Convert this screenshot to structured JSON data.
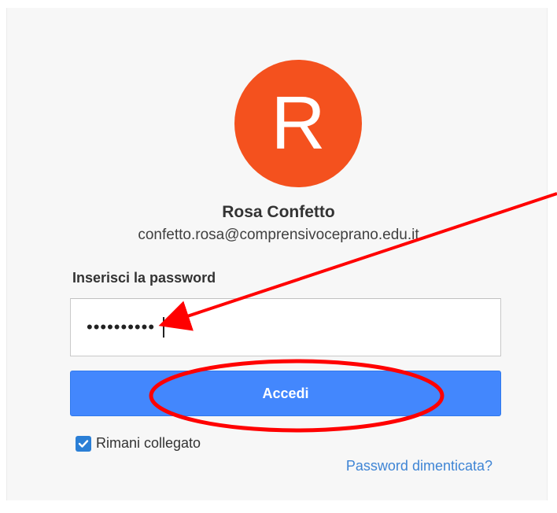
{
  "profile": {
    "avatar_letter": "R",
    "avatar_color": "#f4511e",
    "name": "Rosa Confetto",
    "email": "confetto.rosa@comprensivoceprano.edu.it"
  },
  "password": {
    "label": "Inserisci la password",
    "value_masked": "••••••••••"
  },
  "submit": {
    "label": "Accedi",
    "color": "#4387fd"
  },
  "remember": {
    "label": "Rimani collegato",
    "checked": true
  },
  "forgot_link": "Password dimenticata?",
  "annotations": {
    "arrow_color": "#ff0000",
    "ellipse_color": "#ff0000"
  }
}
